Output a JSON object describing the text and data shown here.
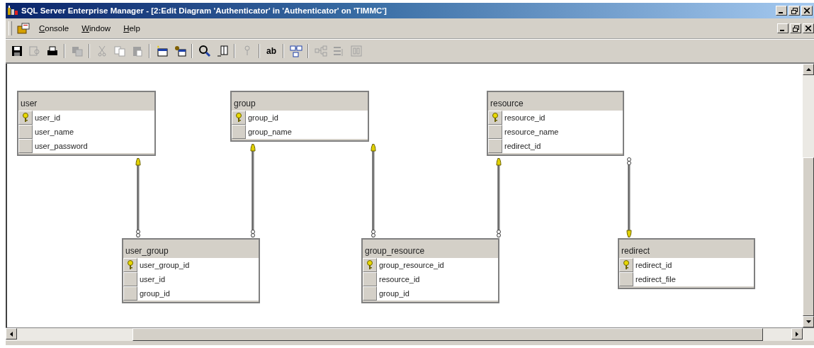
{
  "window": {
    "title": "SQL Server Enterprise Manager - [2:Edit Diagram 'Authenticator' in 'Authenticator' on 'TIMMC']"
  },
  "menu": [
    "Console",
    "Window",
    "Help"
  ],
  "toolbar": [
    {
      "kind": "save",
      "disabled": false
    },
    {
      "kind": "properties",
      "disabled": true
    },
    {
      "kind": "print",
      "disabled": false
    },
    {
      "kind": "separator"
    },
    {
      "kind": "copy-diagram",
      "disabled": true
    },
    {
      "kind": "separator"
    },
    {
      "kind": "cut",
      "disabled": true
    },
    {
      "kind": "copy",
      "disabled": true
    },
    {
      "kind": "paste",
      "disabled": true
    },
    {
      "kind": "separator"
    },
    {
      "kind": "new-table",
      "disabled": false
    },
    {
      "kind": "add-table",
      "disabled": false
    },
    {
      "kind": "separator"
    },
    {
      "kind": "zoom",
      "disabled": false
    },
    {
      "kind": "page-break",
      "disabled": false
    },
    {
      "kind": "separator"
    },
    {
      "kind": "key",
      "disabled": true
    },
    {
      "kind": "separator"
    },
    {
      "kind": "text",
      "label": "ab",
      "disabled": false
    },
    {
      "kind": "separator"
    },
    {
      "kind": "arrange",
      "disabled": false
    },
    {
      "kind": "separator"
    },
    {
      "kind": "relationships",
      "disabled": true
    },
    {
      "kind": "indexes",
      "disabled": true
    },
    {
      "kind": "layout",
      "disabled": true
    }
  ],
  "tables": [
    {
      "name": "user",
      "columns": [
        {
          "name": "user_id",
          "primary_key": true
        },
        {
          "name": "user_name",
          "primary_key": false
        },
        {
          "name": "user_password",
          "primary_key": false
        }
      ]
    },
    {
      "name": "group",
      "columns": [
        {
          "name": "group_id",
          "primary_key": true
        },
        {
          "name": "group_name",
          "primary_key": false
        }
      ]
    },
    {
      "name": "resource",
      "columns": [
        {
          "name": "resource_id",
          "primary_key": true
        },
        {
          "name": "resource_name",
          "primary_key": false
        },
        {
          "name": "redirect_id",
          "primary_key": false
        }
      ]
    },
    {
      "name": "user_group",
      "columns": [
        {
          "name": "user_group_id",
          "primary_key": true
        },
        {
          "name": "user_id",
          "primary_key": false
        },
        {
          "name": "group_id",
          "primary_key": false
        }
      ]
    },
    {
      "name": "group_resource",
      "columns": [
        {
          "name": "group_resource_id",
          "primary_key": true
        },
        {
          "name": "resource_id",
          "primary_key": false
        },
        {
          "name": "group_id",
          "primary_key": false
        }
      ]
    },
    {
      "name": "redirect",
      "columns": [
        {
          "name": "redirect_id",
          "primary_key": true
        },
        {
          "name": "redirect_file",
          "primary_key": false
        }
      ]
    }
  ]
}
